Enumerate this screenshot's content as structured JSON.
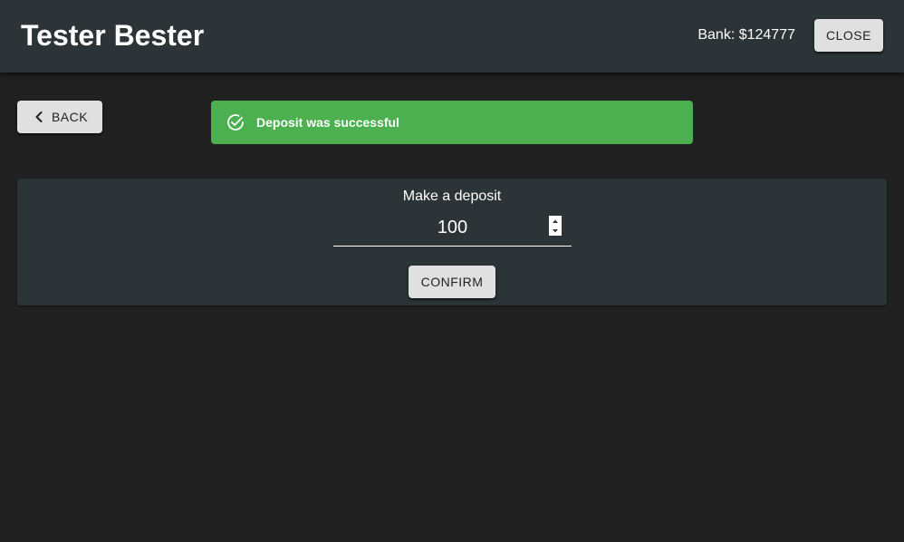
{
  "header": {
    "title": "Tester Bester",
    "bank_text": "Bank: $124777",
    "close_label": "CLOSE"
  },
  "nav": {
    "back_label": "BACK",
    "back_icon": "chevron-left-icon"
  },
  "alert": {
    "message": "Deposit was successful",
    "icon": "check-circle-icon",
    "color": "#4caf50"
  },
  "deposit": {
    "title": "Make a deposit",
    "amount_value": "100",
    "confirm_label": "CONFIRM"
  },
  "colors": {
    "background": "#212121",
    "surface": "#2c3437",
    "button": "#e0e0e0",
    "success": "#4caf50"
  }
}
